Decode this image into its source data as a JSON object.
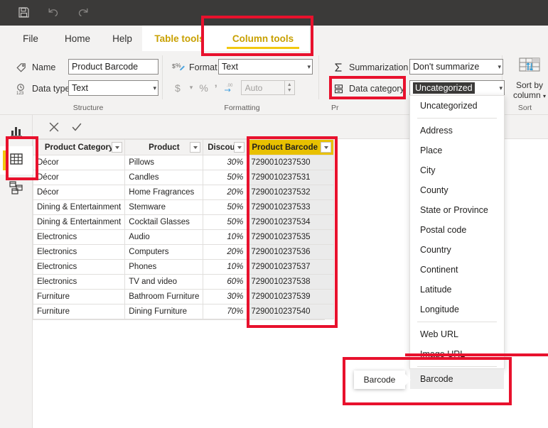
{
  "titlebar": {
    "icons": [
      {
        "name": "save-icon",
        "label": "Save"
      },
      {
        "name": "undo-icon",
        "label": "Undo"
      },
      {
        "name": "redo-icon",
        "label": "Redo"
      }
    ]
  },
  "ribbon": {
    "tabs": [
      {
        "label": "File",
        "active": false
      },
      {
        "label": "Home",
        "active": false
      },
      {
        "label": "Help",
        "active": false
      },
      {
        "label": "Table tools",
        "active": false
      },
      {
        "label": "Column tools",
        "active": true
      }
    ],
    "groups": {
      "structure": {
        "label": "Structure",
        "name_label": "Name",
        "name_value": "Product Barcode",
        "datatype_label": "Data type",
        "datatype_value": "Text"
      },
      "formatting": {
        "label": "Formatting",
        "format_label": "Format",
        "format_value": "Text",
        "currency_glyph": "$",
        "percent_glyph": "%",
        "thousands_glyph": "\u0019",
        "decimal_glyph": ".00",
        "decimals_placeholder": "Auto"
      },
      "properties": {
        "label": "Pr",
        "summarization_label": "Summarization",
        "summarization_value": "Don't summarize",
        "datacategory_label": "Data category",
        "datacategory_value": "Uncategorized"
      },
      "sort": {
        "label": "Sort",
        "button_line1": "Sort by",
        "button_line2": "column"
      }
    }
  },
  "leftnav": {
    "items": [
      {
        "label": "Report view",
        "icon": "chart-icon",
        "active": false
      },
      {
        "label": "Data view",
        "icon": "table-icon",
        "active": true
      },
      {
        "label": "Model view",
        "icon": "model-icon",
        "active": false
      }
    ]
  },
  "formulabar": {
    "cancel_label": "Cancel",
    "confirm_label": "Confirm",
    "value": ""
  },
  "grid": {
    "columns": [
      "Product Category",
      "Product",
      "Discount",
      "Product Barcode"
    ],
    "selected_column": "Product Barcode",
    "rows": [
      [
        "Décor",
        "Pillows",
        "30%",
        "7290010237530"
      ],
      [
        "Décor",
        "Candles",
        "50%",
        "7290010237531"
      ],
      [
        "Décor",
        "Home Fragrances",
        "20%",
        "7290010237532"
      ],
      [
        "Dining & Entertainment",
        "Stemware",
        "50%",
        "7290010237533"
      ],
      [
        "Dining & Entertainment",
        "Cocktail Glasses",
        "50%",
        "7290010237534"
      ],
      [
        "Electronics",
        "Audio",
        "10%",
        "7290010237535"
      ],
      [
        "Electronics",
        "Computers",
        "20%",
        "7290010237536"
      ],
      [
        "Electronics",
        "Phones",
        "10%",
        "7290010237537"
      ],
      [
        "Electronics",
        "TV and video",
        "60%",
        "7290010237538"
      ],
      [
        "Furniture",
        "Bathroom Furniture",
        "30%",
        "7290010237539"
      ],
      [
        "Furniture",
        "Dining Furniture",
        "70%",
        "7290010237540"
      ]
    ]
  },
  "dropdown": {
    "items": [
      {
        "label": "Uncategorized",
        "type": "item",
        "highlighted": false
      },
      {
        "label": "",
        "type": "separator",
        "highlighted": false
      },
      {
        "label": "Address",
        "type": "item",
        "highlighted": false
      },
      {
        "label": "Place",
        "type": "item",
        "highlighted": false
      },
      {
        "label": "City",
        "type": "item",
        "highlighted": false
      },
      {
        "label": "County",
        "type": "item",
        "highlighted": false
      },
      {
        "label": "State or Province",
        "type": "item",
        "highlighted": false
      },
      {
        "label": "Postal code",
        "type": "item",
        "highlighted": false
      },
      {
        "label": "Country",
        "type": "item",
        "highlighted": false
      },
      {
        "label": "Continent",
        "type": "item",
        "highlighted": false
      },
      {
        "label": "Latitude",
        "type": "item",
        "highlighted": false
      },
      {
        "label": "Longitude",
        "type": "item",
        "highlighted": false
      },
      {
        "label": "",
        "type": "separator",
        "highlighted": false
      },
      {
        "label": "Web URL",
        "type": "item",
        "highlighted": false
      },
      {
        "label": "Image URL",
        "type": "item",
        "highlighted": false
      },
      {
        "label": "",
        "type": "separator",
        "highlighted": false
      },
      {
        "label": "Barcode",
        "type": "item",
        "highlighted": true
      }
    ]
  },
  "tooltip": {
    "text": "Barcode"
  },
  "colors": {
    "accent_yellow": "#f2c811",
    "selected_header": "#e8c000",
    "annotation_red": "#e8112d",
    "titlebar": "#3b3a39",
    "ribbon": "#f3f2f1"
  }
}
